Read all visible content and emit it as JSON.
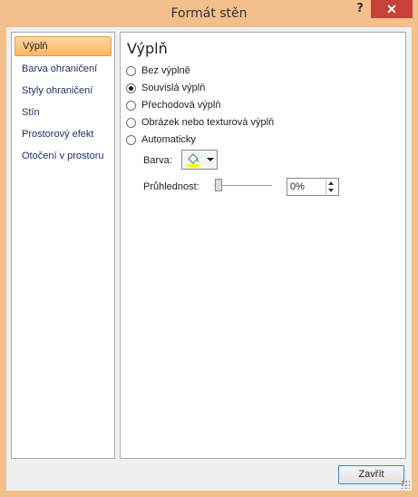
{
  "window": {
    "title": "Formát stěn",
    "help_label": "?",
    "close_label": "✕"
  },
  "sidebar": {
    "items": [
      {
        "label": "Výplň",
        "selected": true
      },
      {
        "label": "Barva ohraničení",
        "selected": false
      },
      {
        "label": "Styly ohraničení",
        "selected": false
      },
      {
        "label": "Stín",
        "selected": false
      },
      {
        "label": "Prostorový efekt",
        "selected": false
      },
      {
        "label": "Otočení v prostoru",
        "selected": false
      }
    ]
  },
  "fill": {
    "section_title": "Výplň",
    "options": [
      {
        "label": "Bez výplně",
        "checked": false
      },
      {
        "label": "Souvislá výplň",
        "checked": true
      },
      {
        "label": "Přechodová výplň",
        "checked": false
      },
      {
        "label": "Obrázek nebo texturová výplň",
        "checked": false
      },
      {
        "label": "Automaticky",
        "checked": false
      }
    ],
    "color_label": "Barva:",
    "transparency_label": "Průhlednost:",
    "transparency_value": "0%",
    "transparency_level": 0,
    "selected_color": "#ffff00"
  },
  "footer": {
    "close_button_label": "Zavřít"
  },
  "colors": {
    "frame": "#f3bf8a",
    "selected_item": "#ffc47a",
    "close_red": "#c7413a"
  },
  "icons": [
    "help-icon",
    "close-icon",
    "paint-bucket-icon",
    "dropdown-arrow-icon",
    "spin-up-icon",
    "spin-down-icon"
  ]
}
